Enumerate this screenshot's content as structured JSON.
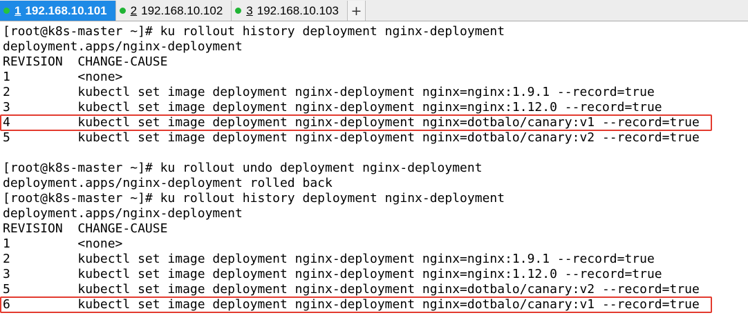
{
  "tabs": [
    {
      "num": "1",
      "label": "192.168.10.101",
      "active": true,
      "status_color": "#27c43c"
    },
    {
      "num": "2",
      "label": "192.168.10.102",
      "active": false,
      "status_color": "#1fb434"
    },
    {
      "num": "3",
      "label": "192.168.10.103",
      "active": false,
      "status_color": "#1fb434"
    }
  ],
  "add_tab_label": "+",
  "terminal": {
    "lines": [
      "[root@k8s-master ~]# ku rollout history deployment nginx-deployment",
      "deployment.apps/nginx-deployment",
      "REVISION  CHANGE-CAUSE",
      "1         <none>",
      "2         kubectl set image deployment nginx-deployment nginx=nginx:1.9.1 --record=true",
      "3         kubectl set image deployment nginx-deployment nginx=nginx:1.12.0 --record=true",
      "4         kubectl set image deployment nginx-deployment nginx=dotbalo/canary:v1 --record=true",
      "5         kubectl set image deployment nginx-deployment nginx=dotbalo/canary:v2 --record=true",
      "",
      "[root@k8s-master ~]# ku rollout undo deployment nginx-deployment",
      "deployment.apps/nginx-deployment rolled back",
      "[root@k8s-master ~]# ku rollout history deployment nginx-deployment",
      "deployment.apps/nginx-deployment",
      "REVISION  CHANGE-CAUSE",
      "1         <none>",
      "2         kubectl set image deployment nginx-deployment nginx=nginx:1.9.1 --record=true",
      "3         kubectl set image deployment nginx-deployment nginx=nginx:1.12.0 --record=true",
      "5         kubectl set image deployment nginx-deployment nginx=dotbalo/canary:v2 --record=true",
      "6         kubectl set image deployment nginx-deployment nginx=dotbalo/canary:v1 --record=true"
    ],
    "highlighted_line_indices": [
      6,
      18
    ],
    "highlight_color": "#e33a2e"
  }
}
